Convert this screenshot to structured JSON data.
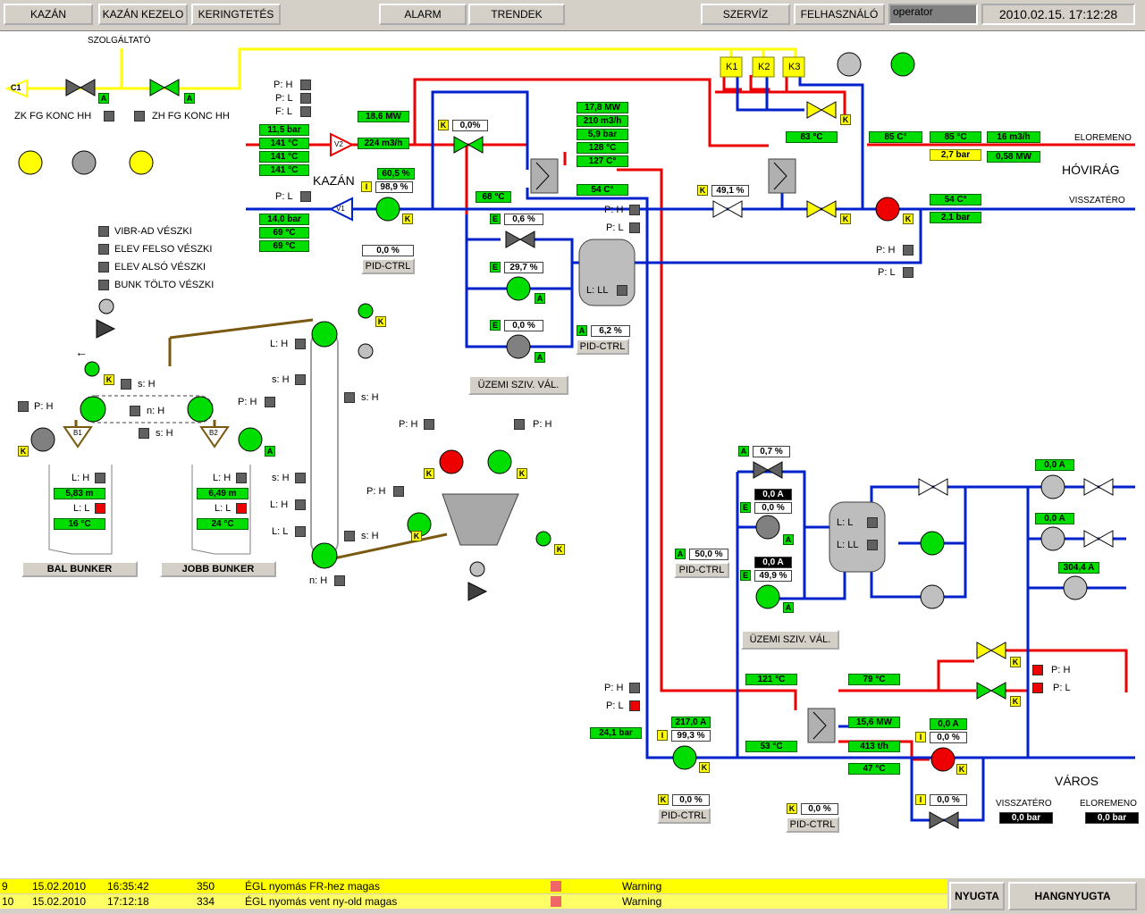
{
  "topbar": {
    "buttons": [
      "KAZÁN",
      "KAZÁN KEZELO",
      "KERINGTETÉS",
      "ALARM",
      "TRENDEK",
      "SZERVÍZ",
      "FELHASZNÁLÓ"
    ],
    "operator": "operator",
    "datetime": "2010.02.15. 17:12:28"
  },
  "labels": {
    "szolgaltato": "SZOLGÁLTATÓ",
    "c1": "C1",
    "zk": "ZK FG KONC HH",
    "zh": "ZH FG KONC HH",
    "kazan": "KAZÁN",
    "v1": "V1",
    "v2": "V2",
    "k1": "K1",
    "k2": "K2",
    "k3": "K3",
    "eloremeno": "ELOREMENO",
    "hovirag": "HÓVIRÁG",
    "visszatero": "VISSZATÉRO",
    "varos": "VÁROS",
    "visszatero2": "VISSZATÉRO",
    "eloremeno2": "ELOREMENO",
    "vibr": "VIBR-AD VÉSZKI",
    "elevfelso": "ELEV FELSO VÉSZKI",
    "elevalso": "ELEV ALSÓ VÉSZKI",
    "bunk": "BUNK TÖLTO VÉSZKI",
    "bal_bunker": "BAL BUNKER",
    "jobb_bunker": "JOBB BUNKER",
    "uzemi1": "ÜZEMI SZIV. VÁL.",
    "uzemi2": "ÜZEMI SZIV. VÁL.",
    "pid": "PID-CTRL",
    "ph": "P: H",
    "pl": "P: L",
    "fl": "F: L",
    "lh": "L: H",
    "ll": "L: L",
    "lll": "L: LL",
    "sh": "s: H",
    "nh": "n: H",
    "b1": "B1",
    "b2": "B2",
    "arrow": "←"
  },
  "values": {
    "p_11_5": "11,5 bar",
    "t141a": "141 °C",
    "t141b": "141 °C",
    "t141c": "141 °C",
    "mw18_6": "18,6 MW",
    "m3h224": "224 m3/h",
    "v60_5": "60,5 %",
    "v98_9": "98,9 %",
    "p14": "14,0 bar",
    "t69a": "69 °C",
    "t69b": "69 °C",
    "pid1": "0,0 %",
    "valve0": "0,0%",
    "t68": "68 °C",
    "mw17_8": "17,8 MW",
    "m3h210": "210 m3/h",
    "p5_9": "5,9 bar",
    "t128": "128 °C",
    "t127": "127 C°",
    "t54": "54 C°",
    "e06": "0,6 %",
    "e29_7": "29,7 %",
    "e0": "0,0 %",
    "a6_2": "6,2 %",
    "k49_1": "49,1 %",
    "t83": "83 °C",
    "t85a": "85 C°",
    "t85b": "85 °C",
    "m3h16": "16 m3/h",
    "p2_7": "2,7 bar",
    "mw0_58": "0,58 MW",
    "t54b": "54 C°",
    "p2_1": "2,1 bar",
    "l583": "5,83 m",
    "t16": "16 °C",
    "l649": "6,49 m",
    "t24": "24 °C",
    "a0_7": "0,7 %",
    "bA1": "0,0 A",
    "e0b": "0,0 %",
    "bA2": "0,0 A",
    "e49_9": "49,9 %",
    "a50": "50,0 %",
    "a0r1": "0,0 A",
    "a0r2": "0,0 A",
    "a304": "304,4 A",
    "t121": "121 °C",
    "t79": "79 °C",
    "t53": "53 °C",
    "mw15_6": "15,6 MW",
    "th413": "413 t/h",
    "t47": "47 °C",
    "p24_1": "24,1 bar",
    "a217": "217,0 A",
    "i99_3": "99,3 %",
    "a0x": "0,0 A",
    "i0x": "0,0 %",
    "i0y": "0,0 %",
    "k0a": "0,0 %",
    "k0b": "0,0 %",
    "visszp": "0,0 bar",
    "elorep": "0,0 bar"
  },
  "alarms": [
    {
      "n": "9",
      "date": "15.02.2010",
      "time": "16:35:42",
      "code": "350",
      "msg": "ÉGL nyomás FR-hez  magas",
      "lvl": "Warning"
    },
    {
      "n": "10",
      "date": "15.02.2010",
      "time": "17:12:18",
      "code": "334",
      "msg": "ÉGL nyomás vent ny-old  magas",
      "lvl": "Warning"
    }
  ],
  "alarm_buttons": {
    "ack": "NYUGTA",
    "sound": "HANGNYUGTA"
  },
  "colors": {
    "steam": "#ee0000",
    "water": "#0022cc",
    "gas": "#ffff00",
    "ok": "#00dd00"
  }
}
